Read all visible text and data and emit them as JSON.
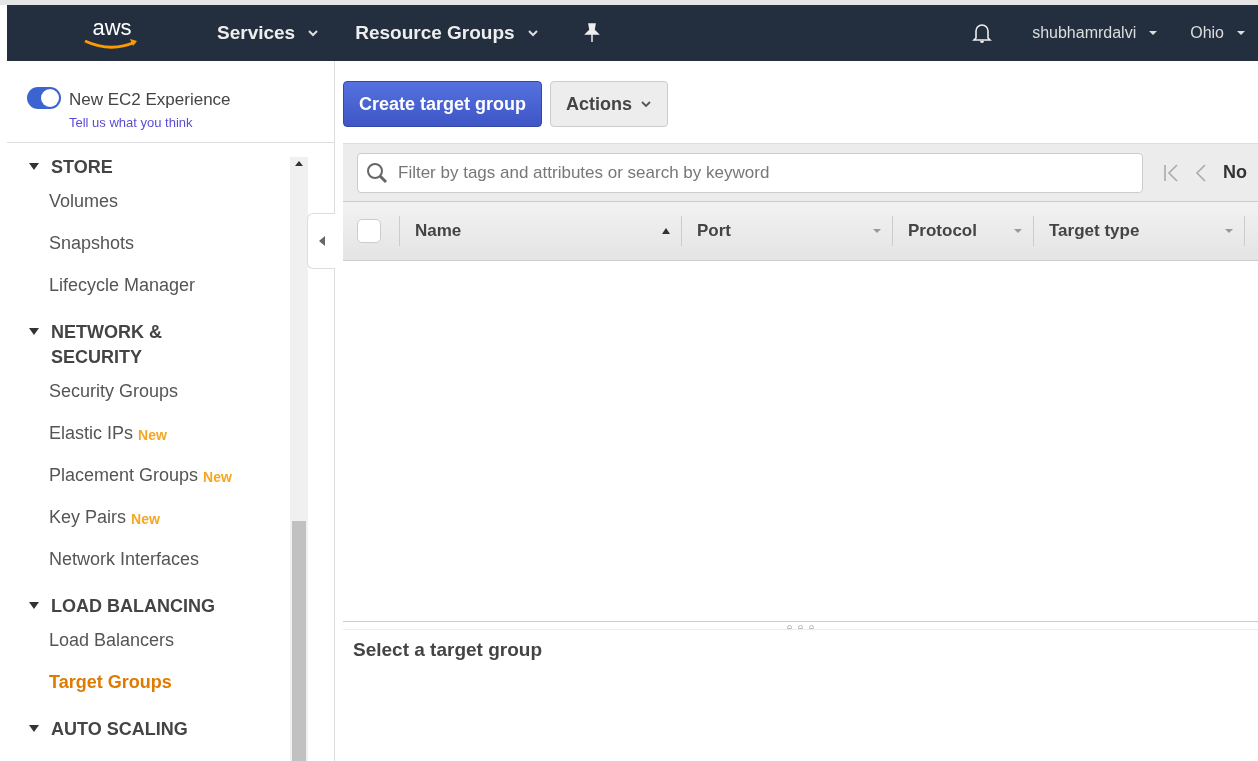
{
  "nav": {
    "logo": "aws",
    "menus": [
      {
        "label": "Services"
      },
      {
        "label": "Resource Groups"
      }
    ],
    "user": "shubhamrdalvi",
    "region": "Ohio"
  },
  "experience": {
    "on": true,
    "label": "New EC2 Experience",
    "link": "Tell us what you think"
  },
  "sidebar": {
    "sections": [
      {
        "title": "STORE",
        "expanded": true,
        "items": [
          {
            "label": "Volumes",
            "selected": false
          },
          {
            "label": "Snapshots",
            "selected": false
          },
          {
            "label": "Lifecycle Manager",
            "selected": false
          }
        ]
      },
      {
        "title": "NETWORK & SECURITY",
        "expanded": true,
        "items": [
          {
            "label": "Security Groups",
            "selected": false
          },
          {
            "label": "Elastic IPs",
            "badge": "New",
            "selected": false
          },
          {
            "label": "Placement Groups",
            "badge": "New",
            "selected": false
          },
          {
            "label": "Key Pairs",
            "badge": "New",
            "selected": false
          },
          {
            "label": "Network Interfaces",
            "selected": false
          }
        ]
      },
      {
        "title": "LOAD BALANCING",
        "expanded": true,
        "items": [
          {
            "label": "Load Balancers",
            "selected": false
          },
          {
            "label": "Target Groups",
            "selected": true
          }
        ]
      },
      {
        "title": "AUTO SCALING",
        "expanded": true
      }
    ]
  },
  "toolbar": {
    "primary": "Create target group",
    "actions": "Actions"
  },
  "search": {
    "placeholder": "Filter by tags and attributes or search by keyword"
  },
  "pager": {
    "text": "No"
  },
  "table": {
    "all_checked": false,
    "columns": [
      {
        "label": "Name",
        "sorted": true
      },
      {
        "label": "Port",
        "sorted": false
      },
      {
        "label": "Protocol",
        "sorted": false
      },
      {
        "label": "Target type",
        "sorted": false
      }
    ]
  },
  "details": {
    "title": "Select a target group"
  }
}
